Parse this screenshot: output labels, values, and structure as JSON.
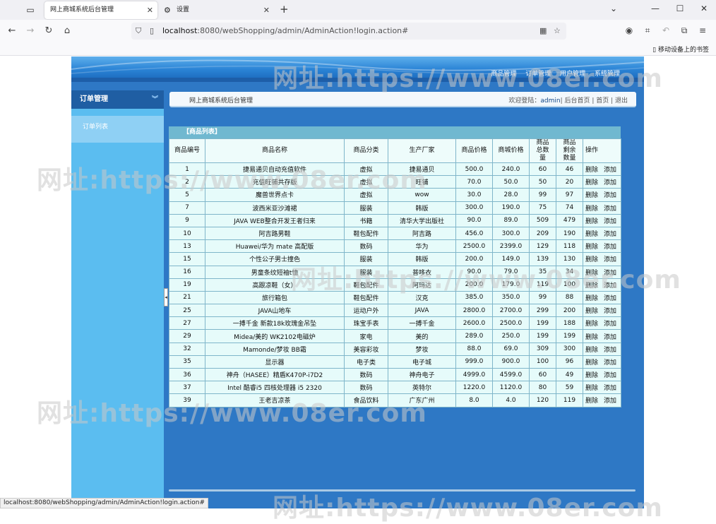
{
  "browser": {
    "tabs": [
      {
        "title": "网上商城系统后台管理",
        "active": true
      },
      {
        "title": "设置",
        "active": false
      }
    ],
    "url_host": "localhost",
    "url_rest": ":8080/webShopping/admin/AdminAction!login.action#",
    "bookmark": "移动设备上的书签",
    "status_url": "localhost:8080/webShopping/admin/AdminAction!login.action#"
  },
  "header": {
    "menu": [
      "商品管理",
      "订单管理",
      "用户管理",
      "系统管理"
    ]
  },
  "sidebar": {
    "title": "订单管理",
    "items": [
      "订单列表"
    ]
  },
  "infobar": {
    "title": "网上商城系统后台管理",
    "welcome": "欢迎登陆：",
    "user": "admin",
    "links": "| 后台首页 | 首页 | 退出"
  },
  "panel": {
    "title": "【商品列表】",
    "columns": [
      "商品编号",
      "商品名称",
      "商品分类",
      "生产厂家",
      "商品价格",
      "商城价格",
      "商品总数量",
      "商品剩余数量",
      "操作"
    ],
    "op_delete": "删除",
    "op_add": "添加",
    "rows": [
      [
        "1",
        "捷易通贝自动充值软件",
        "虚拟",
        "捷易通贝",
        "500.0",
        "240.0",
        "60",
        "46"
      ],
      [
        "2",
        "充值旺铺共存版",
        "虚拟",
        "旺铺",
        "70.0",
        "50.0",
        "50",
        "20"
      ],
      [
        "5",
        "魔兽世界点卡",
        "虚拟",
        "wow",
        "30.0",
        "28.0",
        "99",
        "97"
      ],
      [
        "7",
        "波西米亚沙滩裙",
        "服装",
        "韩版",
        "300.0",
        "190.0",
        "75",
        "74"
      ],
      [
        "9",
        "JAVA WEB整合开发王者归来",
        "书籍",
        "清华大学出版社",
        "90.0",
        "89.0",
        "509",
        "479"
      ],
      [
        "10",
        "阿吉路男鞋",
        "鞋包配件",
        "阿吉路",
        "456.0",
        "300.0",
        "209",
        "190"
      ],
      [
        "13",
        "Huawei/华为 mate 高配版",
        "数码",
        "华为",
        "2500.0",
        "2399.0",
        "129",
        "118"
      ],
      [
        "15",
        "个性公子男士撞色",
        "服装",
        "韩版",
        "200.0",
        "149.0",
        "139",
        "130"
      ],
      [
        "16",
        "男童条纹短袖t恤",
        "服装",
        "普哆衣",
        "90.0",
        "79.0",
        "35",
        "34"
      ],
      [
        "19",
        "高跟凉鞋（女）",
        "鞋包配件",
        "阿玛达",
        "200.0",
        "179.0",
        "119",
        "100"
      ],
      [
        "21",
        "旅行箱包",
        "鞋包配件",
        "汉克",
        "385.0",
        "350.0",
        "99",
        "88"
      ],
      [
        "25",
        "JAVA山地车",
        "运动户外",
        "JAVA",
        "2800.0",
        "2700.0",
        "299",
        "200"
      ],
      [
        "27",
        "一搏千金 新款18k玫瑰金吊坠",
        "珠宝手表",
        "一搏千金",
        "2600.0",
        "2500.0",
        "199",
        "188"
      ],
      [
        "29",
        "Midea/美的 WK2102电磁炉",
        "家电",
        "美的",
        "289.0",
        "250.0",
        "199",
        "199"
      ],
      [
        "32",
        "Mamonde/梦妆 BB霜",
        "美容彩妆",
        "梦妆",
        "88.0",
        "69.0",
        "309",
        "300"
      ],
      [
        "35",
        "显示器",
        "电子类",
        "电子城",
        "999.0",
        "900.0",
        "100",
        "96"
      ],
      [
        "36",
        "神舟（HASEE）精盾K470P-i7D2",
        "数码",
        "神舟电子",
        "4999.0",
        "4599.0",
        "60",
        "49"
      ],
      [
        "37",
        "Intel 酷睿i5 四核处理器 i5 2320",
        "数码",
        "英特尔",
        "1220.0",
        "1120.0",
        "80",
        "59"
      ],
      [
        "39",
        "王老吉凉茶",
        "食品饮料",
        "广东广州",
        "8.0",
        "4.0",
        "120",
        "119"
      ]
    ]
  },
  "watermark": "网址:https://www.08er.com"
}
